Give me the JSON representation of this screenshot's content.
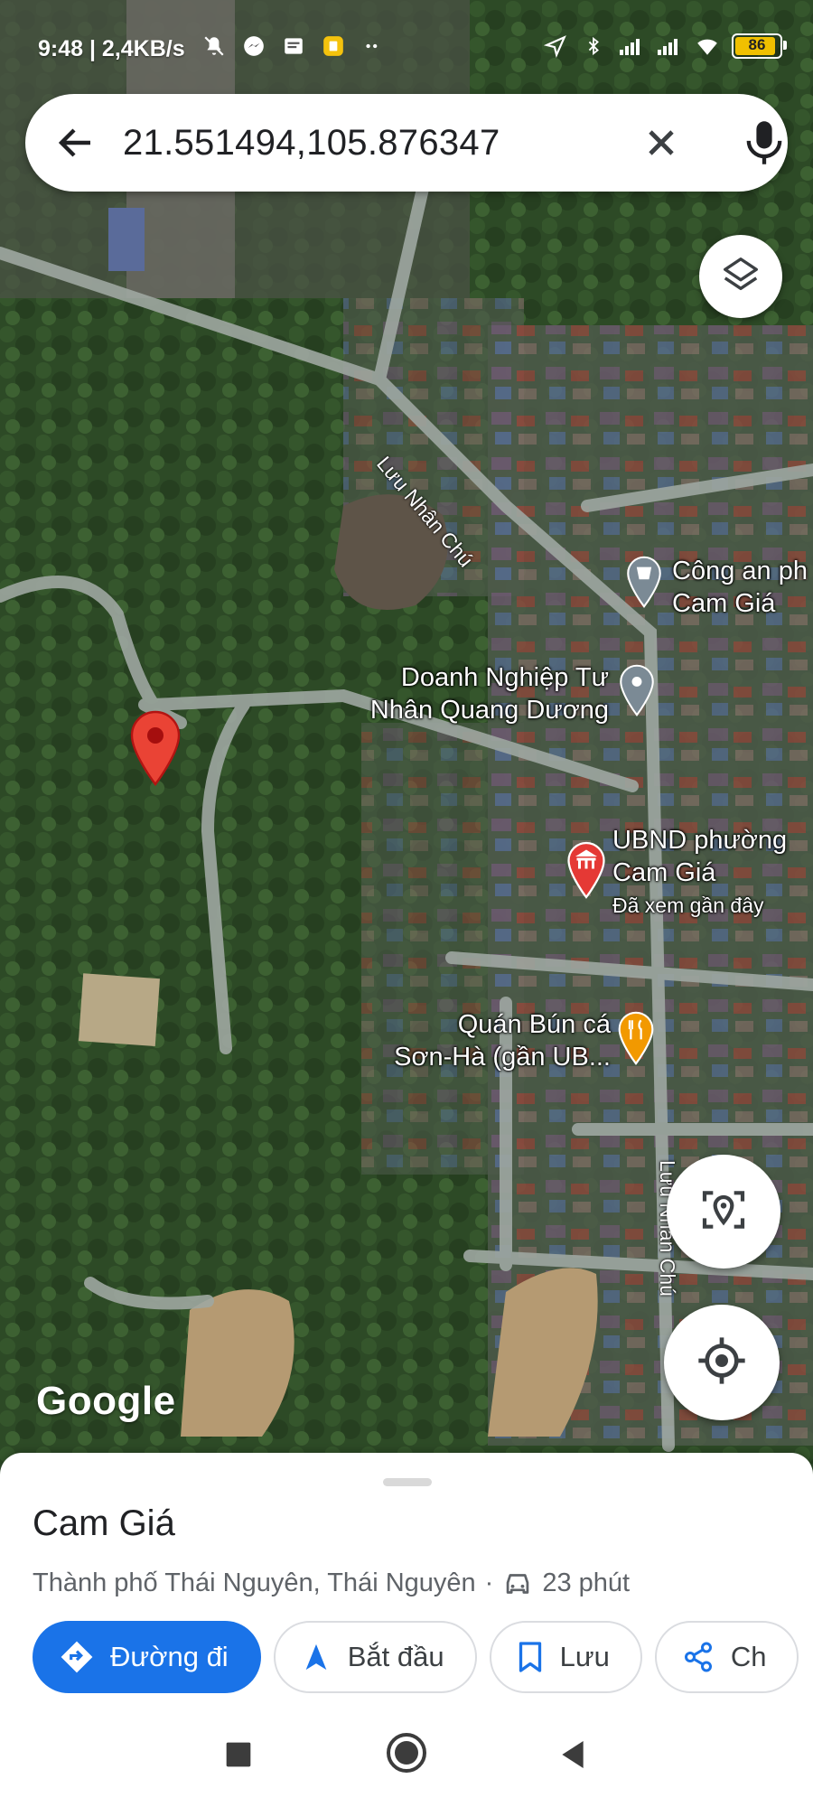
{
  "status_bar": {
    "time": "9:48 | 2,4KB/s",
    "battery": "86",
    "left_icons": [
      "mute-icon",
      "messenger-icon",
      "message-icon",
      "app-icon",
      "more-icon"
    ],
    "right_icons": [
      "location-icon",
      "bluetooth-icon",
      "signal-icon",
      "signal-icon",
      "wifi-icon",
      "battery-icon"
    ]
  },
  "search": {
    "query": "21.551494,105.876347"
  },
  "map": {
    "labels": {
      "cong_an": [
        "Công an ph",
        "Cam Giá"
      ],
      "doanh_nghiep": [
        "Doanh Nghiệp Tư",
        "Nhân Quang Dương"
      ],
      "ubnd": [
        "UBND phường",
        "Cam Giá"
      ],
      "ubnd_note": "Đã xem gần đây",
      "quan_bun": [
        "Quán Bún cá",
        "Sơn-Hà (gần UB..."
      ],
      "road_top": "Lưu Nhân Chú",
      "road_right": "Lưu Nhân Chú"
    },
    "attribution": "Google",
    "colors": {
      "pin": "#ea4335",
      "poi": "#7b8a95",
      "ubnd": "#e53935",
      "food": "#f29900"
    }
  },
  "place": {
    "name": "Cam Giá",
    "address": "Thành phố Thái Nguyên, Thái Nguyên",
    "separator": "·",
    "drive_time": "23 phút"
  },
  "actions": {
    "directions": "Đường đi",
    "start": "Bắt đầu",
    "save": "Lưu",
    "share": "Ch"
  },
  "accent": "#1a73e8"
}
